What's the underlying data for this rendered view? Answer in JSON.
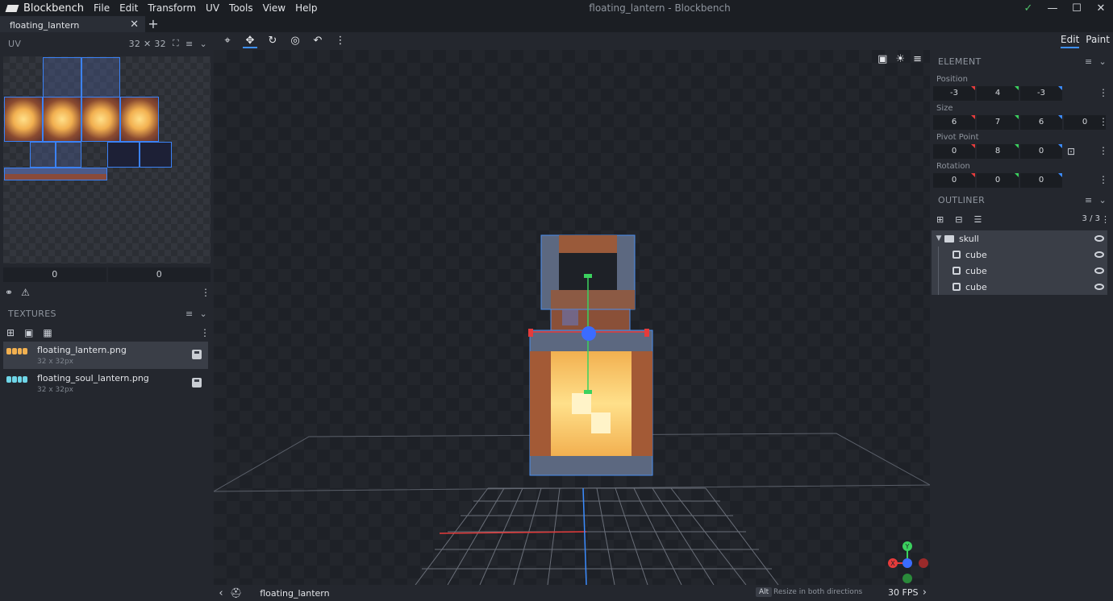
{
  "app": {
    "name": "Blockbench",
    "window_title": "floating_lantern - Blockbench",
    "menu": [
      "File",
      "Edit",
      "Transform",
      "UV",
      "Tools",
      "View",
      "Help"
    ]
  },
  "tabs": [
    {
      "label": "floating_lantern"
    }
  ],
  "uv_panel": {
    "title": "UV",
    "resolution": "32 ✕ 32",
    "inputs": [
      "0",
      "0"
    ]
  },
  "textures_panel": {
    "title": "TEXTURES",
    "items": [
      {
        "name": "floating_lantern.png",
        "size": "32 x 32px",
        "swatch": "#f2b050"
      },
      {
        "name": "floating_soul_lantern.png",
        "size": "32 x 32px",
        "swatch": "#6fd6e8"
      }
    ]
  },
  "mode_tabs": [
    "Edit",
    "Paint"
  ],
  "element_panel": {
    "title": "ELEMENT",
    "position": {
      "label": "Position",
      "values": [
        "-3",
        "4",
        "-3"
      ]
    },
    "size": {
      "label": "Size",
      "values": [
        "6",
        "7",
        "6"
      ],
      "inflate": "0"
    },
    "pivot": {
      "label": "Pivot Point",
      "values": [
        "0",
        "8",
        "0"
      ]
    },
    "rotation": {
      "label": "Rotation",
      "values": [
        "0",
        "0",
        "0"
      ]
    }
  },
  "outliner": {
    "title": "OUTLINER",
    "count": "3 / 3",
    "group": "skull",
    "children": [
      "cube",
      "cube",
      "cube"
    ]
  },
  "status": {
    "model": "floating_lantern",
    "key": "Alt",
    "hint": "Resize in both directions",
    "fps": "30 FPS"
  },
  "gizmo": {
    "y_label": "Y",
    "x_label": "X"
  },
  "colors": {
    "accent": "#3e90ff",
    "axis_x": "#e53b3b",
    "axis_y": "#3bd15e",
    "axis_z": "#3b8cff",
    "lantern_glow": "#ffe08a",
    "lantern_frame": "#5a6478"
  }
}
